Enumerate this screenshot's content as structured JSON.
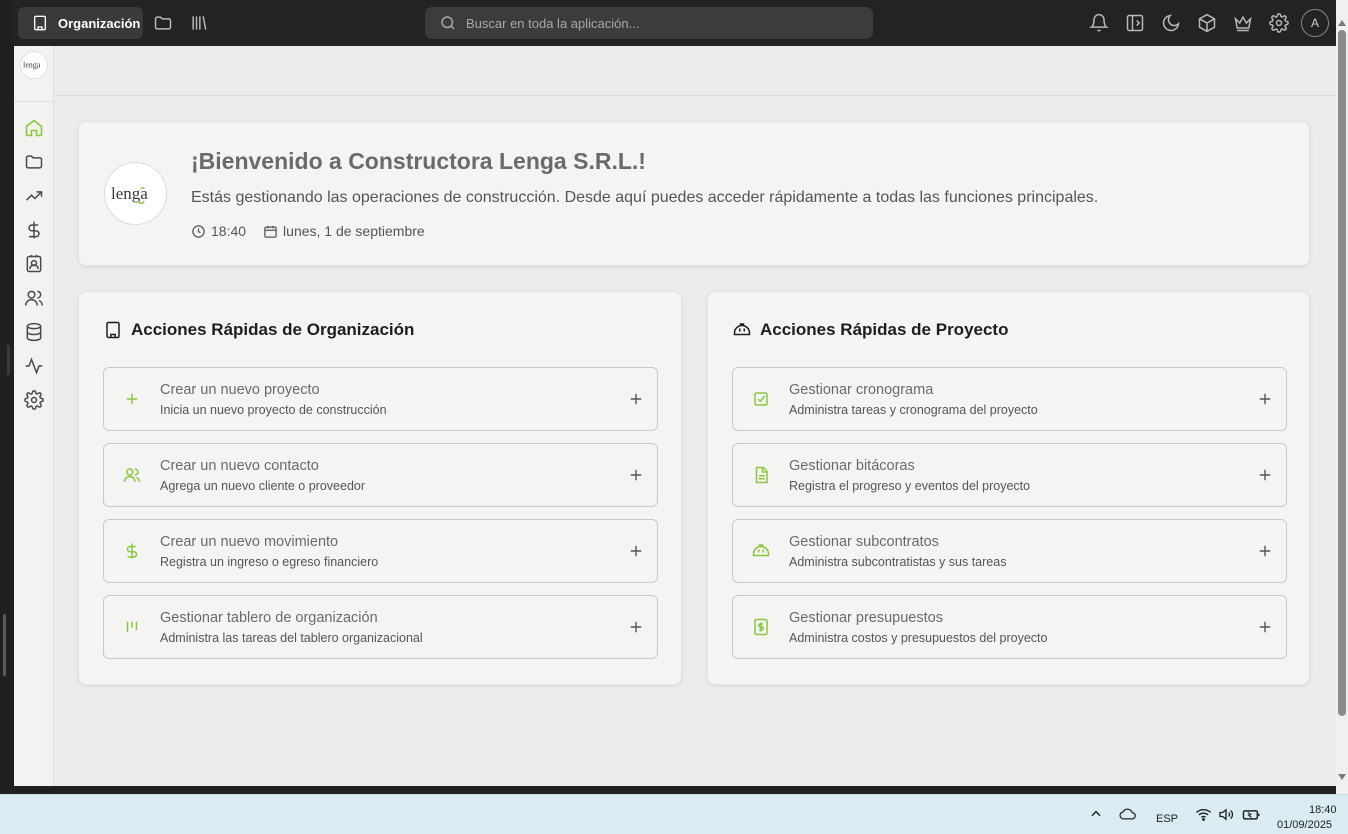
{
  "topbar": {
    "org_label": "Organización",
    "search_placeholder": "Buscar en toda la aplicación...",
    "avatar_initial": "A"
  },
  "sidebar": {
    "items": [
      "home-icon",
      "folder-icon",
      "trending-icon",
      "dollar-icon",
      "contact-card-icon",
      "users-icon",
      "database-icon",
      "activity-icon",
      "settings-icon"
    ],
    "active": "home-icon"
  },
  "welcome": {
    "title": "¡Bienvenido a Constructora Lenga S.R.L.!",
    "description": "Estás gestionando las operaciones de construcción. Desde aquí puedes acceder rápidamente a todas las funciones principales.",
    "time": "18:40",
    "date": "lunes, 1 de septiembre"
  },
  "org_actions": {
    "title": "Acciones Rápidas de Organización",
    "items": [
      {
        "title": "Crear un nuevo proyecto",
        "subtitle": "Inicia un nuevo proyecto de construcción",
        "icon": "plus-icon"
      },
      {
        "title": "Crear un nuevo contacto",
        "subtitle": "Agrega un nuevo cliente o proveedor",
        "icon": "users-icon"
      },
      {
        "title": "Crear un nuevo movimiento",
        "subtitle": "Registra un ingreso o egreso financiero",
        "icon": "dollar-icon"
      },
      {
        "title": "Gestionar tablero de organización",
        "subtitle": "Administra las tareas del tablero organizacional",
        "icon": "kanban-icon"
      }
    ]
  },
  "project_actions": {
    "title": "Acciones Rápidas de Proyecto",
    "items": [
      {
        "title": "Gestionar cronograma",
        "subtitle": "Administra tareas y cronograma del proyecto",
        "icon": "checkbox-icon"
      },
      {
        "title": "Gestionar bitácoras",
        "subtitle": "Registra el progreso y eventos del proyecto",
        "icon": "document-icon"
      },
      {
        "title": "Gestionar subcontratos",
        "subtitle": "Administra subcontratistas y sus tareas",
        "icon": "hardhat-icon"
      },
      {
        "title": "Gestionar presupuestos",
        "subtitle": "Administra costos y presupuestos del proyecto",
        "icon": "receipt-icon"
      }
    ]
  },
  "taskbar": {
    "language": "ESP",
    "time": "18:40",
    "date": "01/09/2025"
  },
  "colors": {
    "accent": "#8cc63f",
    "topbar": "#232323",
    "background": "#ececea"
  }
}
